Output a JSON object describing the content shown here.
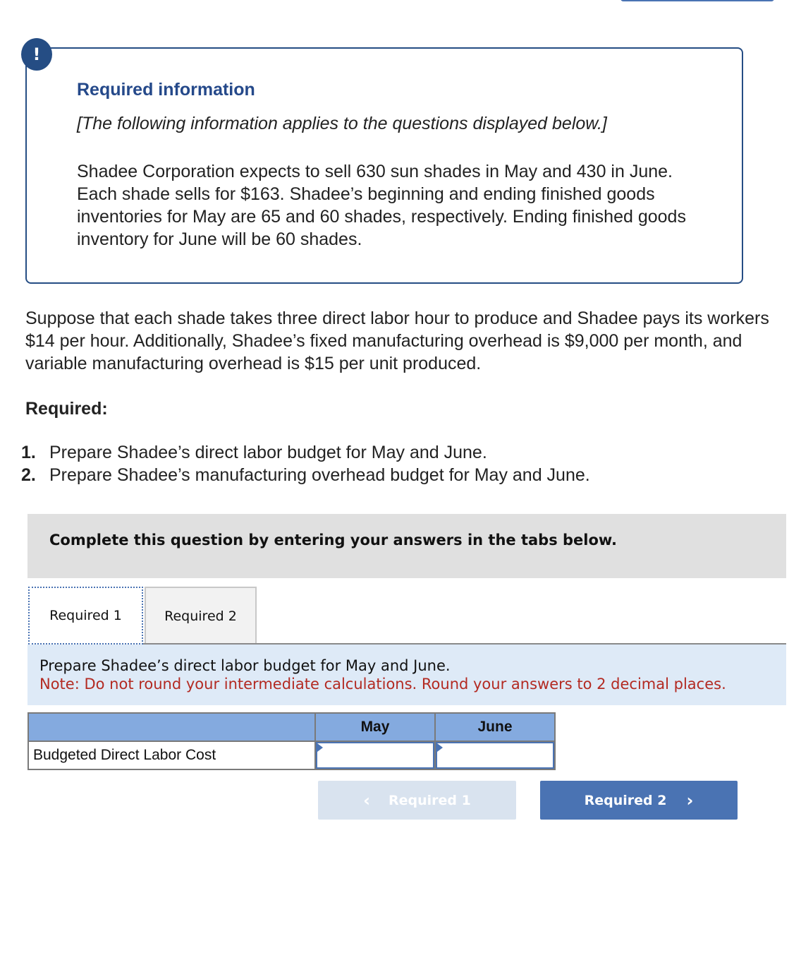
{
  "alert": {
    "icon": "!",
    "title": "Required information",
    "subtitle": "[The following information applies to the questions displayed below.]",
    "body": "Shadee Corporation expects to sell 630 sun shades in May and 430 in June. Each shade sells for $163. Shadee’s beginning and ending finished goods inventories for May are 65 and 60 shades, respectively. Ending finished goods inventory for June will be 60 shades."
  },
  "question": {
    "paragraph": "Suppose that each shade takes three direct labor hour to produce and Shadee pays its workers $14 per hour. Additionally, Shadee’s fixed manufacturing overhead is $9,000 per month, and  variable manufacturing overhead is $15 per unit produced.",
    "required_heading": "Required:",
    "requirements": [
      {
        "num": "1.",
        "text": "Prepare Shadee’s direct labor budget for May and June."
      },
      {
        "num": "2.",
        "text": "Prepare Shadee’s manufacturing overhead budget for May and June."
      }
    ]
  },
  "instructions": "Complete this question by entering your answers in the tabs below.",
  "tabs": [
    {
      "label": "Required 1",
      "active": true
    },
    {
      "label": "Required 2",
      "active": false
    }
  ],
  "prompt": {
    "main": "Prepare Shadee’s direct labor budget for May and June.",
    "note": "Note: Do not round your intermediate calculations. Round your answers to 2 decimal places."
  },
  "table": {
    "columns": [
      "",
      "May",
      "June"
    ],
    "rows": [
      {
        "label": "Budgeted Direct Labor Cost",
        "may": "",
        "june": ""
      }
    ]
  },
  "nav": {
    "prev_label": "Required 1",
    "next_label": "Required 2",
    "prev_icon": "‹",
    "next_icon": "›"
  },
  "colors": {
    "accent": "#4a73b3",
    "alert_navy": "#254d84",
    "note_red": "#b32a22",
    "header_blue": "#84aadf"
  }
}
